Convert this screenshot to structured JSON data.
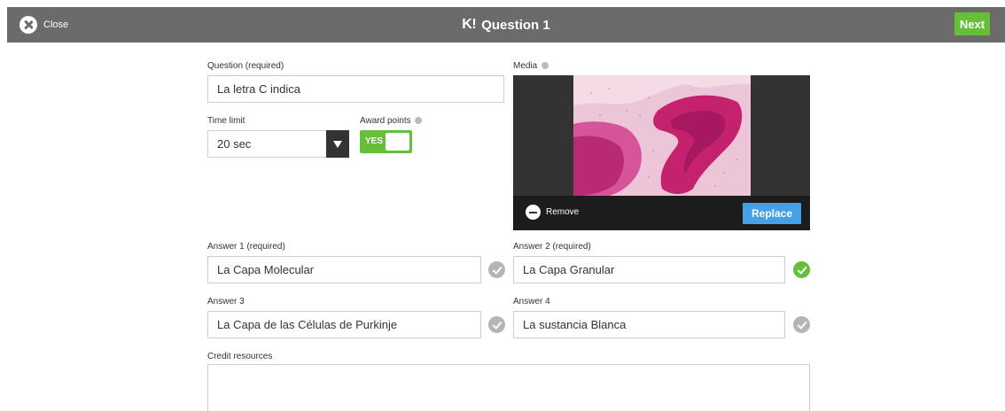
{
  "topbar": {
    "close_label": "Close",
    "logo": "K!",
    "title": "Question 1",
    "next_label": "Next"
  },
  "question": {
    "label": "Question (required)",
    "value": "La letra C indica"
  },
  "time_limit": {
    "label": "Time limit",
    "value": "20 sec"
  },
  "award_points": {
    "label": "Award points",
    "toggle_label": "YES",
    "enabled": true
  },
  "media": {
    "label": "Media",
    "remove_label": "Remove",
    "replace_label": "Replace"
  },
  "answers": [
    {
      "label": "Answer 1 (required)",
      "value": "La Capa Molecular",
      "correct": false
    },
    {
      "label": "Answer 2 (required)",
      "value": "La Capa Granular",
      "correct": true
    },
    {
      "label": "Answer 3",
      "value": "La Capa de las Células de Purkinje",
      "correct": false
    },
    {
      "label": "Answer 4",
      "value": "La sustancia Blanca",
      "correct": false
    }
  ],
  "credit": {
    "label": "Credit resources",
    "value": ""
  },
  "colors": {
    "topbar": "#6b6b6b",
    "accent_green": "#66bf39",
    "replace_blue": "#46a0e6"
  }
}
